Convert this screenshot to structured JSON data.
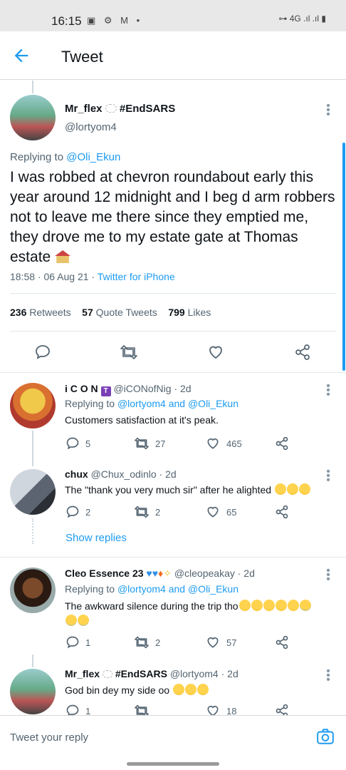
{
  "status_bar": {
    "time": "16:15",
    "left_icons": "▣ ⚙ M •",
    "right_icons": "⊶ 4G .ıl .ıl ▮"
  },
  "header": {
    "title": "Tweet"
  },
  "main_tweet": {
    "name": "Mr_flex",
    "hashtag": "#EndSARS",
    "handle": "@lortyom4",
    "replying_prefix": "Replying to",
    "replying_to": "@Oli_Ekun",
    "text": "I was robbed at chevron roundabout early this year around 12 midnight and I beg d arm robbers not to leave me there since they emptied me, they drove me to my estate gate at Thomas estate",
    "time": "18:58 · 06 Aug 21 · ",
    "client": "Twitter for iPhone",
    "retweets_count": "236",
    "retweets_label": "Retweets",
    "quotes_count": "57",
    "quotes_label": "Quote Tweets",
    "likes_count": "799",
    "likes_label": "Likes"
  },
  "replies": [
    {
      "name": "i C O N",
      "handle": "@iCONofNig",
      "age": "· 2d",
      "replying_prefix": "Replying to",
      "replying_to": "@lortyom4 and @Oli_Ekun",
      "text": "Customers satisfaction at it's peak.",
      "replies": "5",
      "retweets": "27",
      "likes": "465"
    },
    {
      "name": "chux",
      "handle": "@Chux_odinlo",
      "age": "· 2d",
      "text": "The \"thank you very much sir\" after he alighted",
      "replies": "2",
      "retweets": "2",
      "likes": "65"
    },
    {
      "name": "Cleo Essence 23",
      "handle": "@cleopeakay",
      "age": "· 2d",
      "replying_prefix": "Replying to",
      "replying_to": "@lortyom4 and @Oli_Ekun",
      "text": "The awkward silence during the trip tho",
      "replies": "1",
      "retweets": "2",
      "likes": "57"
    },
    {
      "name": "Mr_flex",
      "hashtag": "#EndSARS",
      "handle": "@lortyom4",
      "age": "· 2d",
      "text": "God bin dey my side oo",
      "replies": "1",
      "retweets": "",
      "likes": "18"
    }
  ],
  "show_replies": "Show replies",
  "composer": {
    "placeholder": "Tweet your reply"
  },
  "colors": {
    "accent": "#1d9bf0",
    "text": "#0f1419",
    "secondary": "#536471"
  }
}
